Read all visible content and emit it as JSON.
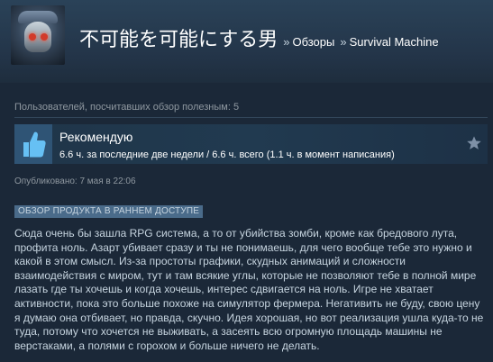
{
  "header": {
    "username": "不可能を可能にする男",
    "separator": "»",
    "crumb_reviews": "Обзоры",
    "crumb_game": "Survival Machine"
  },
  "review": {
    "helpful_text": "Пользователей, посчитавших обзор полезным: 5",
    "recommendation": "Рекомендую",
    "hours": "6.6 ч. за последние две недели / 6.6 ч. всего (1.1 ч. в момент написания)",
    "posted": "Опубликовано: 7 мая в 22:06",
    "early_access_badge": "ОБЗОР ПРОДУКТА В РАННЕМ ДОСТУПЕ",
    "body": "Сюда очень бы зашла RPG система, а то от убийства зомби, кроме как бредового лута, профита ноль. Азарт убивает сразу и ты не понимаешь, для чего вообще тебе это нужно и какой в этом смысл. Из-за простоты графики, скудных анимаций и сложности взаимодействия с миром, тут и там всякие углы, которые не позволяют тебе в полной мире лазать где ты хочешь и когда хочешь, интерес сдвигается на ноль. Игре не хватает активности, пока это больше похоже на симулятор фермера. Негативить не буду, свою цену я думаю она отбивает, но правда, скучно. Идея хорошая, но вот реализация ушла куда-то не туда, потому что хочется не выживать, а засеять всю огромную площадь машины не верстаками, а полями с горохом и больше ничего не делать."
  },
  "icons": {
    "thumb": "thumbs-up-icon",
    "star": "star-icon",
    "avatar": "user-avatar"
  },
  "colors": {
    "background": "#1b2838",
    "accent_blue": "#4a6b8a",
    "thumb_box": "#2f5475",
    "thumb_icon": "#66c0f4"
  }
}
